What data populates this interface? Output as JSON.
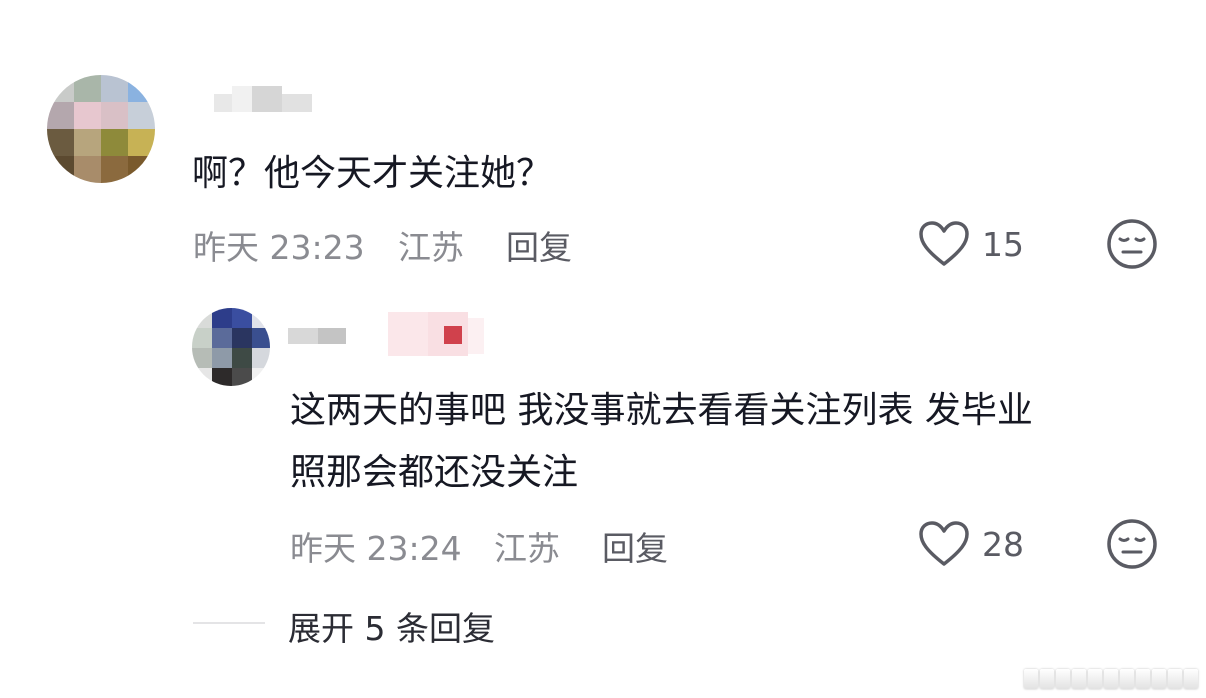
{
  "comment": {
    "avatar": "pixelated-user-avatar",
    "author": "",
    "text": "啊？他今天才关注她？",
    "time": "昨天 23:23",
    "location": "江苏",
    "reply_label": "回复",
    "likes": "15",
    "like_icon": "heart-outline-icon",
    "dislike_icon": "meh-face-icon"
  },
  "reply": {
    "avatar": "pixelated-user-avatar",
    "author": "",
    "text_line1": "这两天的事吧 我没事就去看看关注列表 发毕业",
    "text_line2": "照那会都还没关注",
    "time": "昨天 23:24",
    "location": "江苏",
    "reply_label": "回复",
    "likes": "28",
    "like_icon": "heart-outline-icon",
    "dislike_icon": "meh-face-icon"
  },
  "expand_replies": "展开 5 条回复",
  "colors": {
    "primary_text": "#161823",
    "meta_text": "#8a8b91",
    "secondary_text": "#5a5b63",
    "background": "#ffffff"
  }
}
